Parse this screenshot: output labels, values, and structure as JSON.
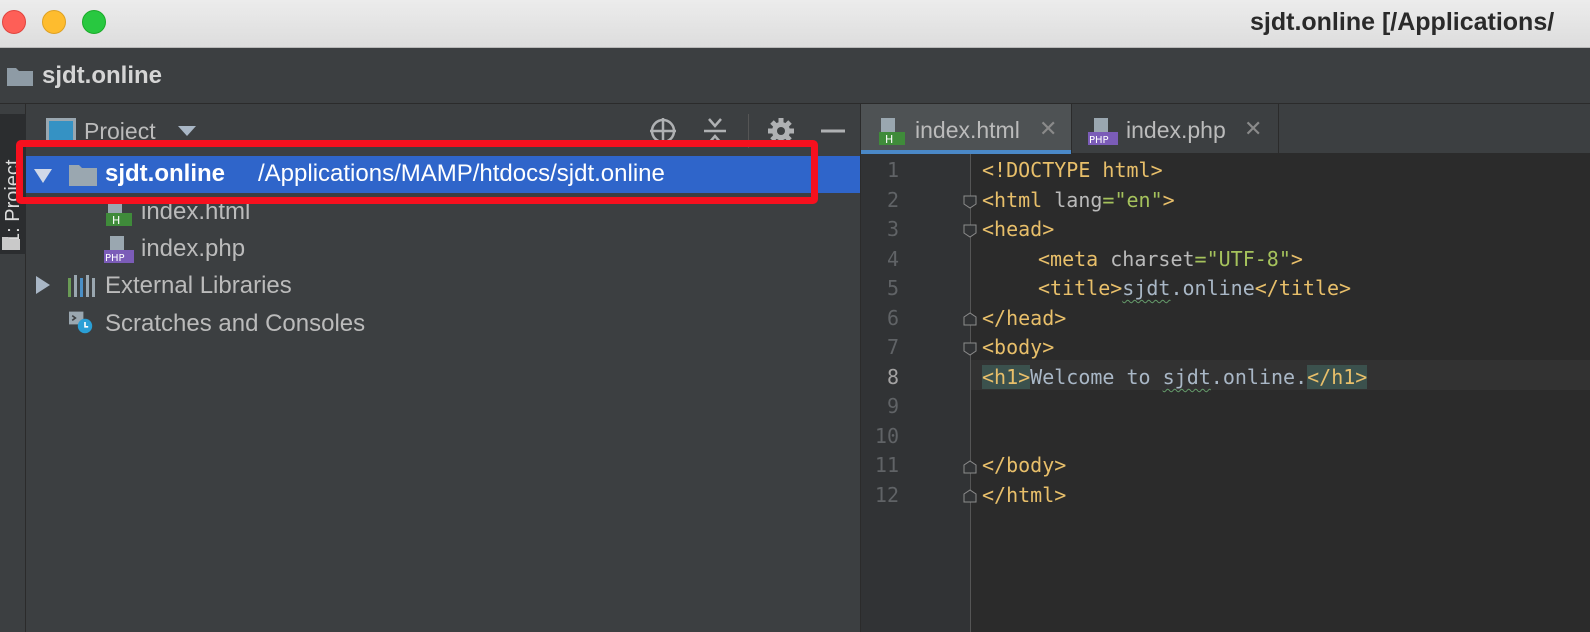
{
  "window": {
    "title": "sjdt.online [/Applications/"
  },
  "navbar": {
    "breadcrumb": "sjdt.online"
  },
  "toolstrip": {
    "project_tab": "1: Project"
  },
  "project_panel": {
    "view_label": "Project",
    "root": {
      "name": "sjdt.online",
      "path": "/Applications/MAMP/htdocs/sjdt.online"
    },
    "files": [
      {
        "name": "index.html",
        "icon": "html-file-icon"
      },
      {
        "name": "index.php",
        "icon": "php-file-icon"
      }
    ],
    "external_libraries": "External Libraries",
    "scratches": "Scratches and Consoles"
  },
  "editor": {
    "tabs": [
      {
        "label": "index.html",
        "icon_text": "H",
        "active": true
      },
      {
        "label": "index.php",
        "icon_text": "PHP",
        "active": false
      }
    ],
    "current_line": 8,
    "line_numbers": [
      "1",
      "2",
      "3",
      "4",
      "5",
      "6",
      "7",
      "8",
      "9",
      "10",
      "11",
      "12"
    ],
    "code": {
      "l1": "<!DOCTYPE html>",
      "l2_open": "<html ",
      "l2_attr": "lang",
      "l2_eq": "=",
      "l2_val": "\"en\"",
      "l2_close": ">",
      "l3": "<head>",
      "l4_open": "<meta ",
      "l4_attr": "charset",
      "l4_eq": "=",
      "l4_val": "\"UTF-8\"",
      "l4_close": ">",
      "l5_open": "<title>",
      "l5_text_a": "sjdt",
      "l5_text_b": ".online",
      "l5_close": "</title>",
      "l6": "</head>",
      "l7": "<body>",
      "l8_open": "<h1>",
      "l8_text_a": "Welcome to ",
      "l8_text_b": "sjdt",
      "l8_text_c": ".online.",
      "l8_close": "</h1>",
      "l11": "</body>",
      "l12": "</html>"
    }
  },
  "colors": {
    "selection": "#2f65ca",
    "highlight_border": "#f6101e",
    "tag": "#e8bf6a",
    "string": "#a5c25c"
  }
}
